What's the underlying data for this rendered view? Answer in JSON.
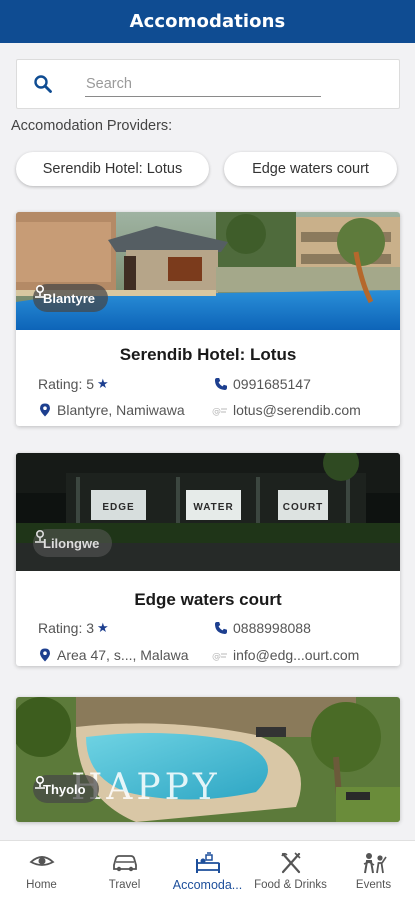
{
  "header": {
    "title": "Accomodations"
  },
  "search": {
    "placeholder": "Search",
    "value": ""
  },
  "providers": {
    "label": "Accomodation Providers:",
    "chips": [
      "Serendib Hotel: Lotus",
      "Edge waters court"
    ]
  },
  "cards": [
    {
      "location_badge": "Blantyre",
      "name": "Serendib Hotel: Lotus",
      "rating_label": "Rating: 5",
      "phone": "0991685147",
      "address": "Blantyre, Namiwawa",
      "email": "lotus@serendib.com"
    },
    {
      "location_badge": "Lilongwe",
      "name": "Edge waters court",
      "rating_label": "Rating: 3",
      "phone": "0888998088",
      "address": "Area 47, s..., Malawa",
      "email": "info@edg...ourt.com",
      "sign_letters": [
        "EDGE",
        "WATER",
        "COURT"
      ]
    },
    {
      "location_badge": "Thyolo",
      "image_text": "HAPPY"
    }
  ],
  "bottom_nav": [
    {
      "label": "Home",
      "icon": "eye-icon"
    },
    {
      "label": "Travel",
      "icon": "car-icon"
    },
    {
      "label": "Accomoda...",
      "icon": "hotel-bed-icon",
      "active": true
    },
    {
      "label": "Food & Drinks",
      "icon": "fork-knife-icon"
    },
    {
      "label": "Events",
      "icon": "people-icon"
    }
  ],
  "colors": {
    "primary": "#0f4c92",
    "accent": "#1d3f8f",
    "background": "#f2f2f4"
  }
}
